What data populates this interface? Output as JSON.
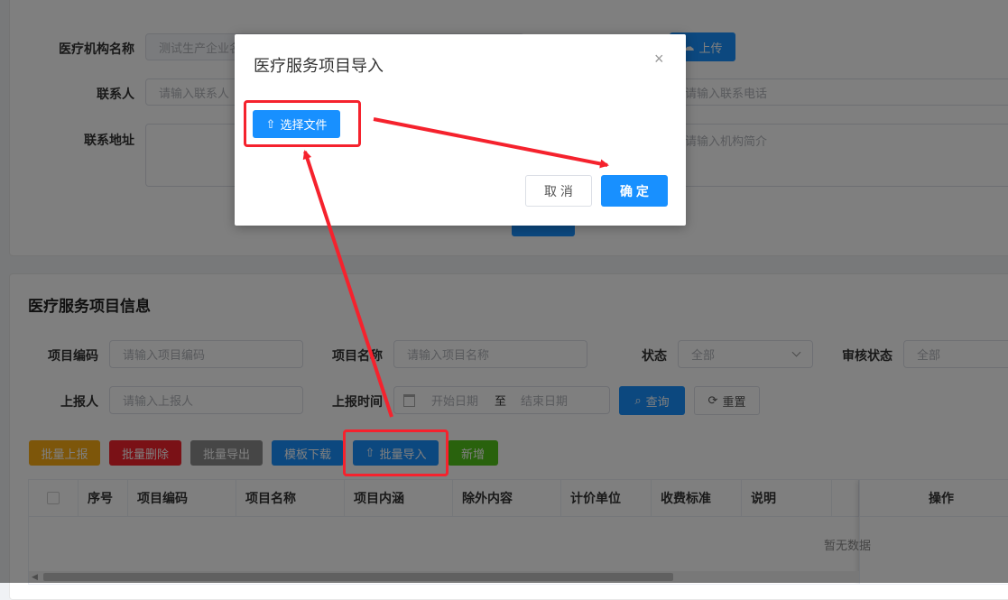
{
  "org_form": {
    "name_label": "医疗机构名称",
    "name_value": "测试生产企业名",
    "upload_label": "上传",
    "contact_label": "联系人",
    "contact_placeholder": "请输入联系人",
    "phone_placeholder": "请输入联系电话",
    "address_label": "联系地址",
    "intro_placeholder": "请输入机构简介"
  },
  "project_section": {
    "title": "医疗服务项目信息",
    "filters": {
      "code_label": "项目编码",
      "code_placeholder": "请输入项目编码",
      "name_label": "项目名称",
      "name_placeholder": "请输入项目名称",
      "status_label": "状态",
      "status_value": "全部",
      "audit_label": "审核状态",
      "audit_value": "全部",
      "reporter_label": "上报人",
      "reporter_placeholder": "请输入上报人",
      "time_label": "上报时间",
      "start_placeholder": "开始日期",
      "range_sep": "至",
      "end_placeholder": "结束日期",
      "search_label": "查询",
      "reset_label": "重置"
    },
    "actions": {
      "batch_report": "批量上报",
      "batch_delete": "批量删除",
      "batch_export": "批量导出",
      "template_download": "模板下载",
      "batch_import": "批量导入",
      "add": "新增"
    },
    "table": {
      "columns": [
        "序号",
        "项目编码",
        "项目名称",
        "项目内涵",
        "除外内容",
        "计价单位",
        "收费标准",
        "说明",
        "操作"
      ],
      "empty_text": "暂无数据"
    }
  },
  "modal": {
    "title": "医疗服务项目导入",
    "select_file_label": "选择文件",
    "cancel_label": "取 消",
    "confirm_label": "确 定"
  },
  "colors": {
    "primary": "#1890ff",
    "annotation_red": "#f5222d",
    "warning": "#faad14",
    "danger": "#f5222d",
    "gray_button": "#8c8c8c",
    "success": "#52c41a"
  },
  "icons": [
    "upload-icon",
    "close-icon",
    "search-icon",
    "refresh-icon",
    "calendar-icon",
    "chevron-down-icon",
    "cloud-upload-icon"
  ]
}
